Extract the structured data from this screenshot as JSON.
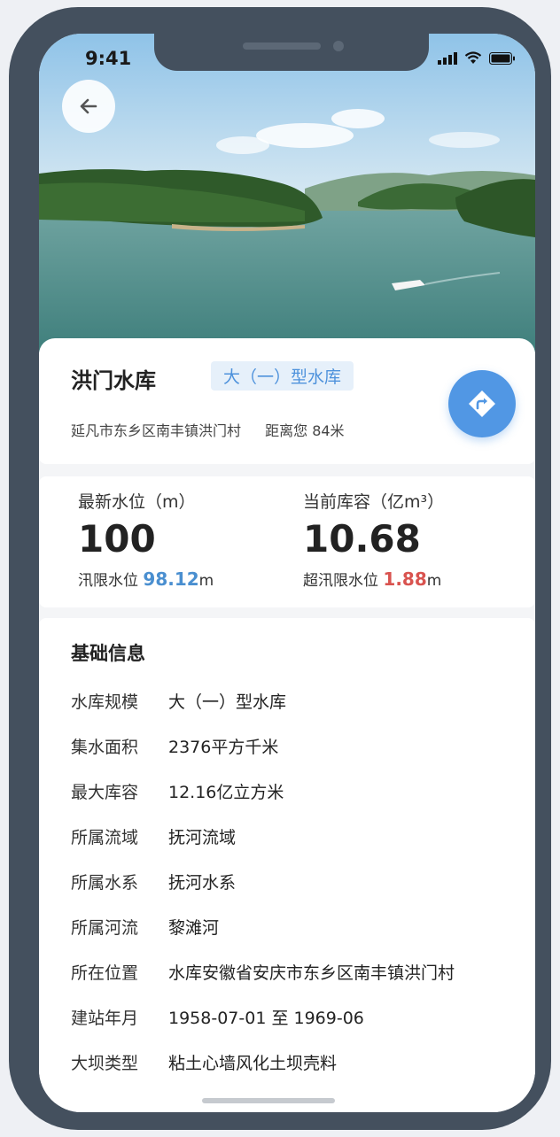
{
  "status_bar": {
    "time": "9:41"
  },
  "reservoir": {
    "name": "洪门水库",
    "type_badge": "大（一）型水库",
    "address": "延凡市东乡区南丰镇洪门村",
    "distance": "距离您 84米"
  },
  "metrics": {
    "water_level": {
      "label": "最新水位（m）",
      "value": "100",
      "sub_label": "汛限水位",
      "sub_value": "98.12",
      "sub_unit": "m",
      "sub_color": "#4a8fd0"
    },
    "storage": {
      "label": "当前库容（亿m³）",
      "value": "10.68",
      "sub_label": "超汛限水位",
      "sub_value": "1.88",
      "sub_unit": "m",
      "sub_color": "#d9534f"
    }
  },
  "basic_info": {
    "title": "基础信息",
    "rows": [
      {
        "key": "水库规模",
        "value": "大（一）型水库"
      },
      {
        "key": "集水面积",
        "value": "2376平方千米"
      },
      {
        "key": "最大库容",
        "value": "12.16亿立方米"
      },
      {
        "key": "所属流域",
        "value": "抚河流域"
      },
      {
        "key": "所属水系",
        "value": "抚河水系"
      },
      {
        "key": "所属河流",
        "value": "黎滩河"
      },
      {
        "key": "所在位置",
        "value": "水库安徽省安庆市东乡区南丰镇洪门村"
      },
      {
        "key": "建站年月",
        "value": "1958-07-01 至 1969-06"
      },
      {
        "key": "大坝类型",
        "value": "粘土心墙风化土坝壳料"
      }
    ]
  },
  "icons": {
    "back": "arrow-left-icon",
    "navigate": "route-turn-icon",
    "signal": "signal-icon",
    "wifi": "wifi-icon",
    "battery": "battery-icon"
  },
  "colors": {
    "accent": "#5197e4",
    "phone_frame": "#44505e"
  }
}
